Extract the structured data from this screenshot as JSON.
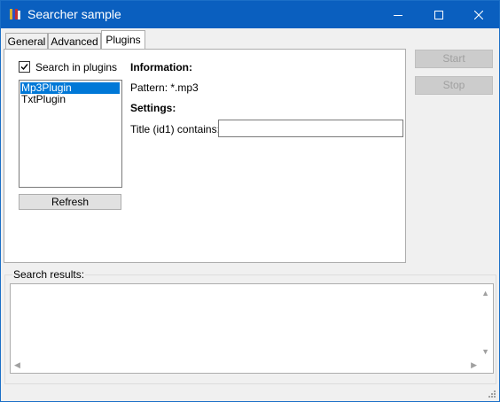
{
  "window": {
    "title": "Searcher sample",
    "icon": "books-icon",
    "controls": [
      "minimize-icon",
      "maximize-icon",
      "close-icon"
    ]
  },
  "tabs": [
    {
      "label": "General",
      "active": false
    },
    {
      "label": "Advanced",
      "active": false
    },
    {
      "label": "Plugins",
      "active": true
    }
  ],
  "plugins": {
    "search_checkbox_label": "Search in plugins",
    "search_checked": true,
    "list": [
      {
        "label": "Mp3Plugin",
        "selected": true
      },
      {
        "label": "TxtPlugin",
        "selected": false
      }
    ],
    "refresh_label": "Refresh",
    "info_heading": "Information:",
    "pattern_text": "Pattern: *.mp3",
    "settings_heading": "Settings:",
    "title_field_label": "Title (id1) contains:",
    "title_field_value": ""
  },
  "actions": {
    "start_label": "Start",
    "stop_label": "Stop",
    "start_enabled": false,
    "stop_enabled": false
  },
  "results": {
    "label": "Search results:",
    "content": ""
  },
  "colors": {
    "titlebar": "#0a5fbf",
    "selection": "#0078d7"
  }
}
